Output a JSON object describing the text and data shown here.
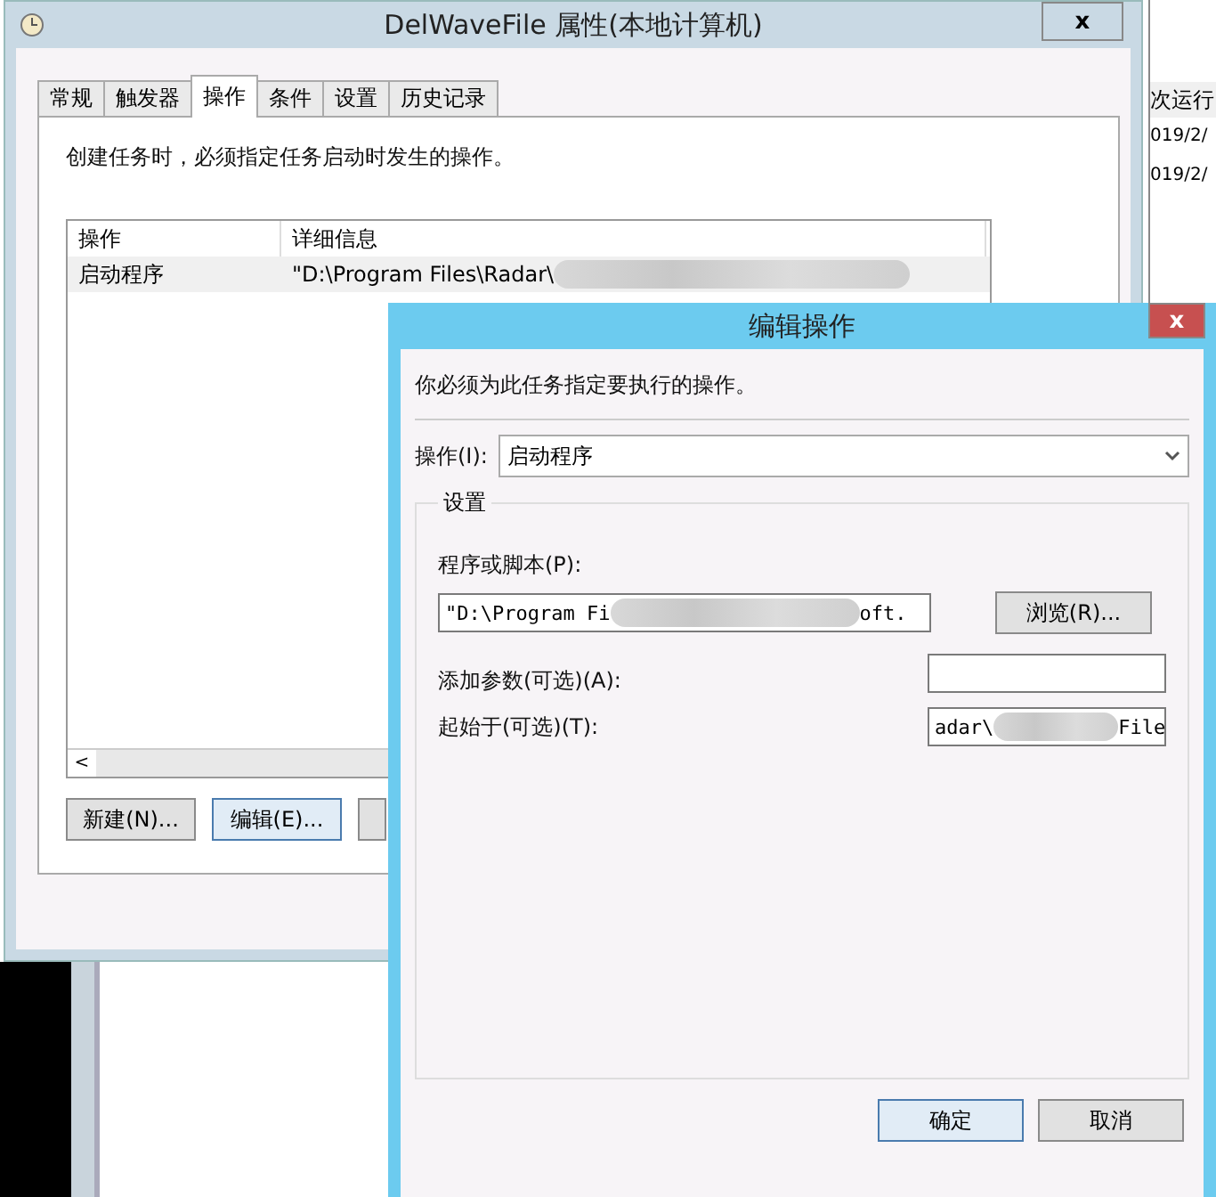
{
  "main_window": {
    "title": "DelWaveFile 属性(本地计算机)",
    "close": "x",
    "tabs": [
      {
        "label": "常规",
        "selected": false
      },
      {
        "label": "触发器",
        "selected": false
      },
      {
        "label": "操作",
        "selected": true
      },
      {
        "label": "条件",
        "selected": false
      },
      {
        "label": "设置",
        "selected": false
      },
      {
        "label": "历史记录",
        "selected": false
      }
    ],
    "description": "创建任务时，必须指定任务启动时发生的操作。",
    "table": {
      "columns": [
        "操作",
        "详细信息"
      ],
      "rows": [
        {
          "action": "启动程序",
          "details": "\"D:\\Program Files\\Radar\\",
          "selected": true
        }
      ]
    },
    "scroll_left": "<",
    "buttons": [
      {
        "label": "新建(N)...",
        "focused": false
      },
      {
        "label": "编辑(E)...",
        "focused": true
      },
      {
        "focused": false
      }
    ]
  },
  "background_window": {
    "column_header": "次运行",
    "cells": [
      "019/2/",
      "019/2/"
    ]
  },
  "dialog": {
    "title": "编辑操作",
    "close": "x",
    "description": "你必须为此任务指定要执行的操作。",
    "action_label": "操作(I):",
    "action_value": "启动程序",
    "group_title": "设置",
    "program_label": "程序或脚本(P):",
    "program_value_start": "\"D:\\Program Fi",
    "program_value_end": "oft.",
    "browse": "浏览(R)...",
    "args_label": "添加参数(可选)(A):",
    "start_label": "起始于(可选)(T):",
    "start_value_start": "adar\\",
    "start_value_end": "File",
    "buttons": [
      {
        "label": "确定",
        "focused": true
      },
      {
        "label": "取消",
        "focused": false
      }
    ]
  }
}
